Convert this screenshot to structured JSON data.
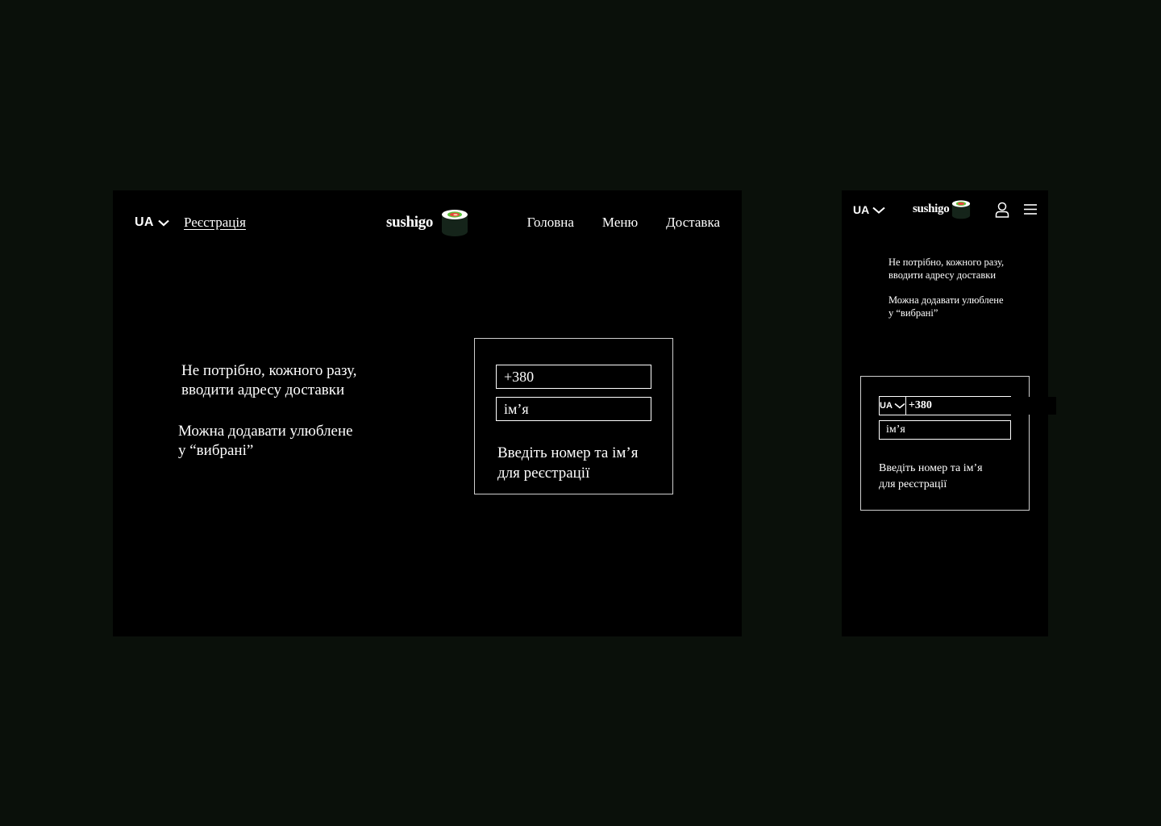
{
  "desktop": {
    "header": {
      "language": "UA",
      "register_link": "Реєстрація",
      "logo_text": "sushigo",
      "nav": [
        "Головна",
        "Меню",
        "Доставка"
      ]
    },
    "benefits": {
      "line1": "Не потрібно, кожного разу,",
      "line2": "вводити адресу доставки",
      "line3": "Можна додавати улюблене",
      "line4": "у “вибрані”"
    },
    "form": {
      "phone_placeholder": "+380",
      "name_placeholder": "ім’я",
      "hint_line1": "Введіть номер та ім’я",
      "hint_line2": "для реєстрації"
    }
  },
  "mobile": {
    "header": {
      "language": "UA",
      "logo_text": "sushigo"
    },
    "benefits": {
      "line1": "Не потрібно, кожного разу,",
      "line2": "вводити адресу доставки",
      "line3": "Можна додавати улюблене",
      "line4": "у “вибрані”"
    },
    "form": {
      "country_code": "UA",
      "phone_placeholder": "+380",
      "name_placeholder": "ім’я",
      "hint_line1": "Введіть номер та ім’я",
      "hint_line2": "для реєстрації"
    }
  },
  "icons": {
    "language_chevron": "chevron-down-icon",
    "logo_mark": "sushi-roll-icon",
    "user": "user-icon",
    "menu": "hamburger-menu-icon"
  },
  "colors": {
    "page_background": "#0a100a",
    "frame_background": "#000000",
    "text": "#ffffff",
    "sushi_nori": "#15241a",
    "sushi_rice": "#ffffff",
    "sushi_filling_red": "#e8453c",
    "sushi_filling_green": "#5cc43a"
  }
}
